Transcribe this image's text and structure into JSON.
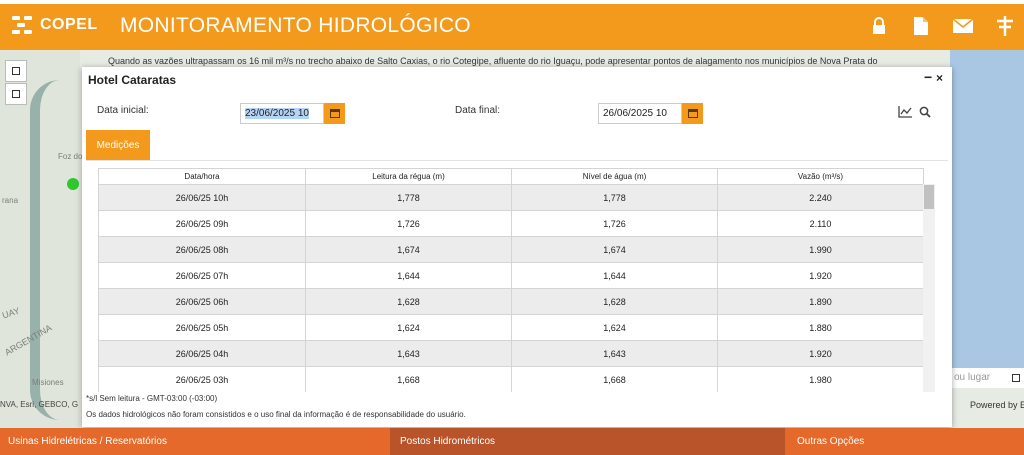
{
  "header": {
    "logo_text": "COPEL",
    "title": "MONITORAMENTO HIDROLÓGICO",
    "icons": [
      "lock-icon",
      "document-icon",
      "mail-icon",
      "tower-icon"
    ]
  },
  "map": {
    "info_text": "Quando as vazões ultrapassam os 16 mil m³/s no trecho abaixo de Salto Caxias, o rio Cotegipe, afluente do rio Iguaçu, pode apresentar pontos de alagamento nos municípios de Nova Prata do",
    "labels": {
      "foz": "Foz do",
      "rana": "rana",
      "uay": "UAY",
      "argentina": "ARGENTINA",
      "misiones": "Misiones",
      "attribution": "NVA, Esri, GEBCO, G"
    },
    "search_placeholder": "ou lugar",
    "powered_by": "Powered by E"
  },
  "dialog": {
    "title": "Hotel Cataratas",
    "minimize": "−",
    "close": "×",
    "start_label": "Data inicial:",
    "start_value": "23/06/2025 10",
    "end_label": "Data final:",
    "end_value": "26/06/2025 10",
    "tab_label": "Medições",
    "table": {
      "headers": [
        "Data/hora",
        "Leitura da régua (m)",
        "Nível de água (m)",
        "Vazão (m³/s)"
      ],
      "rows": [
        [
          "26/06/25 10h",
          "1,778",
          "1,778",
          "2.240"
        ],
        [
          "26/06/25 09h",
          "1,726",
          "1,726",
          "2.110"
        ],
        [
          "26/06/25 08h",
          "1,674",
          "1,674",
          "1.990"
        ],
        [
          "26/06/25 07h",
          "1,644",
          "1,644",
          "1.920"
        ],
        [
          "26/06/25 06h",
          "1,628",
          "1,628",
          "1.890"
        ],
        [
          "26/06/25 05h",
          "1,624",
          "1,624",
          "1.880"
        ],
        [
          "26/06/25 04h",
          "1,643",
          "1,643",
          "1.920"
        ],
        [
          "26/06/25 03h",
          "1,668",
          "1,668",
          "1.980"
        ]
      ]
    },
    "note_legend": "*s/l Sem leitura - GMT-03:00 (-03:00)",
    "note_disclaimer": "Os dados hidrológicos não foram consistidos e o uso final da informação é de responsabilidade do usuário."
  },
  "footer": {
    "items": [
      "Usinas Hidrelétricas / Reservatórios",
      "Postos Hidrométricos",
      "Outras Opções"
    ]
  },
  "colors": {
    "accent": "#f39a1c",
    "footer_primary": "#e4692a",
    "footer_active": "#b8532a"
  }
}
